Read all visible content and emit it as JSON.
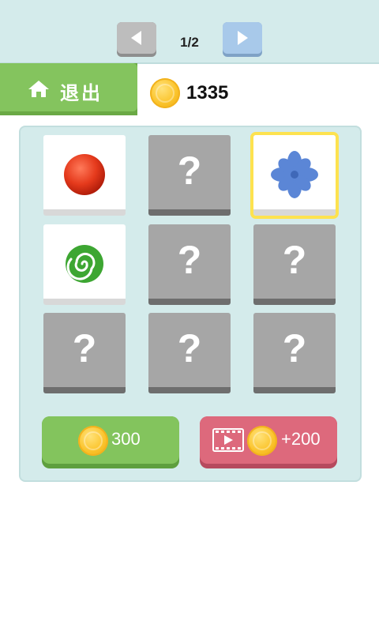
{
  "pager": {
    "label": "1/2"
  },
  "header": {
    "exit_label": "退出",
    "coins": "1335"
  },
  "cards": [
    {
      "state": "open",
      "item": "red-ball"
    },
    {
      "state": "hidden",
      "symbol": "?"
    },
    {
      "state": "open",
      "item": "blue-flower",
      "selected": true
    },
    {
      "state": "open",
      "item": "green-swirl"
    },
    {
      "state": "hidden",
      "symbol": "?"
    },
    {
      "state": "hidden",
      "symbol": "?"
    },
    {
      "state": "hidden",
      "symbol": "?"
    },
    {
      "state": "hidden",
      "symbol": "?"
    },
    {
      "state": "hidden",
      "symbol": "?"
    }
  ],
  "actions": {
    "buy_label": "300",
    "video_label": "+200"
  },
  "colors": {
    "topbar": "#d4ebeb",
    "green": "#84c45e",
    "red": "#dd697c",
    "highlight": "#fde24f"
  }
}
